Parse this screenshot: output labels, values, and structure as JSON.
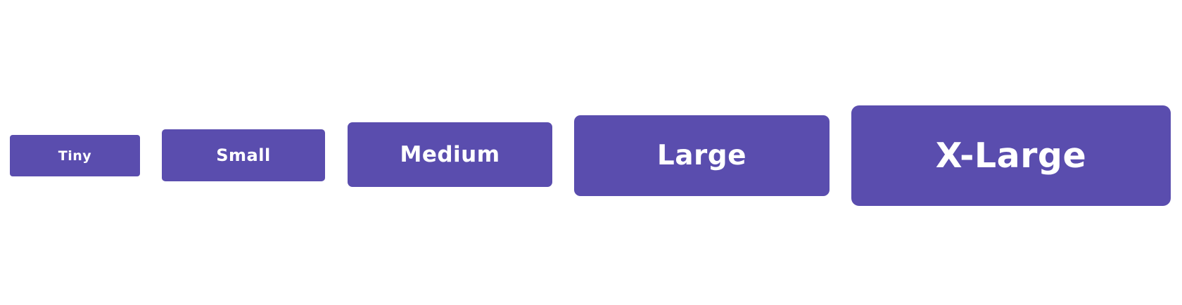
{
  "buttons": {
    "tiny": {
      "label": "Tiny"
    },
    "small": {
      "label": "Small"
    },
    "medium": {
      "label": "Medium"
    },
    "large": {
      "label": "Large"
    },
    "xlarge": {
      "label": "X-Large"
    }
  },
  "colors": {
    "button_background": "#5a4dae",
    "button_text": "#ffffff",
    "page_background": "#ffffff"
  }
}
